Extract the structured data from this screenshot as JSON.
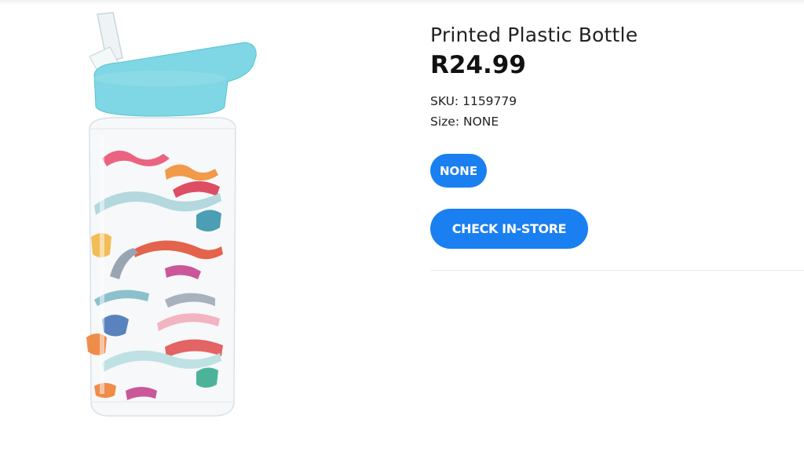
{
  "product": {
    "title": "Printed Plastic Bottle",
    "price": "R24.99",
    "sku_label": "SKU:",
    "sku": "1159779",
    "size_label": "Size:",
    "size": "NONE",
    "image_alt": "dinosaur-print-water-bottle"
  },
  "size_options": [
    "NONE"
  ],
  "actions": {
    "check_in_store": "CHECK IN-STORE"
  },
  "colors": {
    "accent": "#1a7ff0",
    "lid": "#7fd6e4"
  }
}
